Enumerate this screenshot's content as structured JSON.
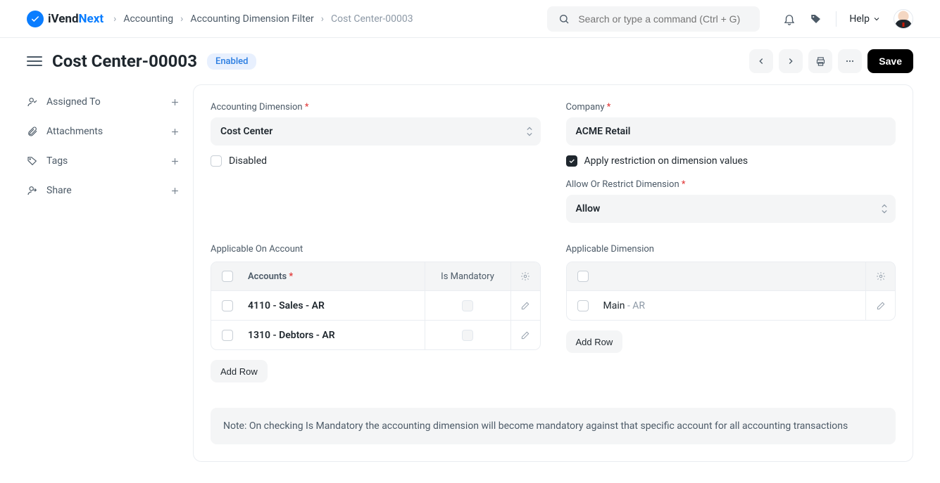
{
  "logo": {
    "text1": "iVend",
    "text2": "Next"
  },
  "breadcrumbs": [
    "Accounting",
    "Accounting Dimension Filter",
    "Cost Center-00003"
  ],
  "search_placeholder": "Search or type a command (Ctrl + G)",
  "help_label": "Help",
  "page_title": "Cost Center-00003",
  "status_badge": "Enabled",
  "save_label": "Save",
  "sidebar": [
    {
      "label": "Assigned To"
    },
    {
      "label": "Attachments"
    },
    {
      "label": "Tags"
    },
    {
      "label": "Share"
    }
  ],
  "fields": {
    "accounting_dimension": {
      "label": "Accounting Dimension",
      "value": "Cost Center"
    },
    "disabled": {
      "label": "Disabled"
    },
    "company": {
      "label": "Company",
      "value": "ACME Retail"
    },
    "apply_restriction": {
      "label": "Apply restriction on dimension values"
    },
    "allow_restrict": {
      "label": "Allow Or Restrict Dimension",
      "value": "Allow"
    }
  },
  "accounts_section": {
    "title": "Applicable On Account",
    "col_accounts": "Accounts",
    "col_mandatory": "Is Mandatory",
    "rows": [
      {
        "text": "4110 - Sales - AR"
      },
      {
        "text": "1310 - Debtors - AR"
      }
    ],
    "add_row": "Add Row"
  },
  "dimensions_section": {
    "title": "Applicable Dimension",
    "rows": [
      {
        "text": "Main",
        "suffix": " - AR"
      }
    ],
    "add_row": "Add Row"
  },
  "note": "Note: On checking Is Mandatory the accounting dimension will become mandatory against that specific account for all accounting transactions"
}
